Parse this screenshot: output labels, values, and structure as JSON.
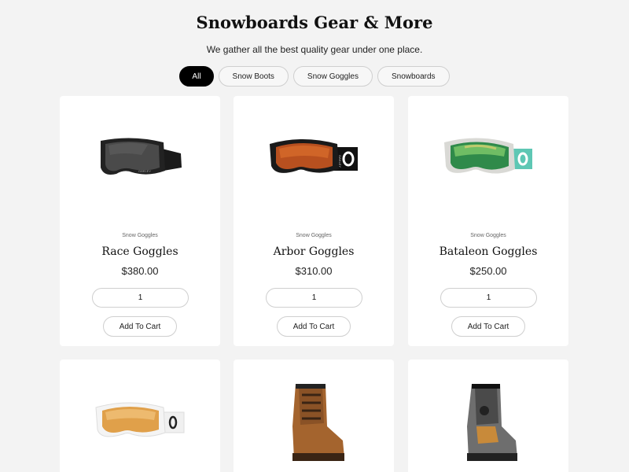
{
  "header": {
    "title": "Snowboards Gear & More",
    "subtitle": "We gather all the best quality gear under one place."
  },
  "filters": [
    {
      "label": "All",
      "active": true
    },
    {
      "label": "Snow Boots",
      "active": false
    },
    {
      "label": "Snow Goggles",
      "active": false
    },
    {
      "label": "Snowboards",
      "active": false
    }
  ],
  "products": [
    {
      "category": "Snow Goggles",
      "name": "Race Goggles",
      "price": "$380.00",
      "qty": "1",
      "button": "Add To Cart",
      "image": "black-goggles-image"
    },
    {
      "category": "Snow Goggles",
      "name": "Arbor Goggles",
      "price": "$310.00",
      "qty": "1",
      "button": "Add To Cart",
      "image": "orange-lens-goggles-image"
    },
    {
      "category": "Snow Goggles",
      "name": "Bataleon Goggles",
      "price": "$250.00",
      "qty": "1",
      "button": "Add To Cart",
      "image": "green-lens-goggles-image"
    },
    {
      "image": "white-goggles-image"
    },
    {
      "image": "brown-snow-boot-image"
    },
    {
      "image": "grey-snow-boot-image"
    }
  ],
  "colors": {
    "background": "#f3f3f3",
    "card": "#ffffff",
    "active_pill": "#000000",
    "border": "#cfcfcf"
  }
}
